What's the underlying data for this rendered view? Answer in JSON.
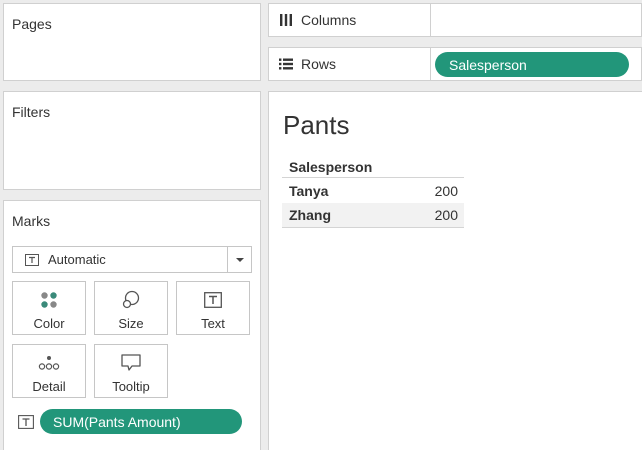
{
  "pages": {
    "title": "Pages"
  },
  "filters": {
    "title": "Filters"
  },
  "marks": {
    "title": "Marks",
    "type_selected": "Automatic",
    "buttons": {
      "color": "Color",
      "size": "Size",
      "text": "Text",
      "detail": "Detail",
      "tooltip": "Tooltip"
    },
    "field_pill": "SUM(Pants Amount)"
  },
  "columns_shelf": {
    "label": "Columns"
  },
  "rows_shelf": {
    "label": "Rows",
    "pill": "Salesperson"
  },
  "view": {
    "title": "Pants",
    "table": {
      "header": "Salesperson",
      "rows": [
        {
          "name": "Tanya",
          "value": "200"
        },
        {
          "name": "Zhang",
          "value": "200"
        }
      ]
    }
  },
  "colors": {
    "pill": "#22967a",
    "background": "#ececec",
    "border": "#d0d0d0"
  }
}
